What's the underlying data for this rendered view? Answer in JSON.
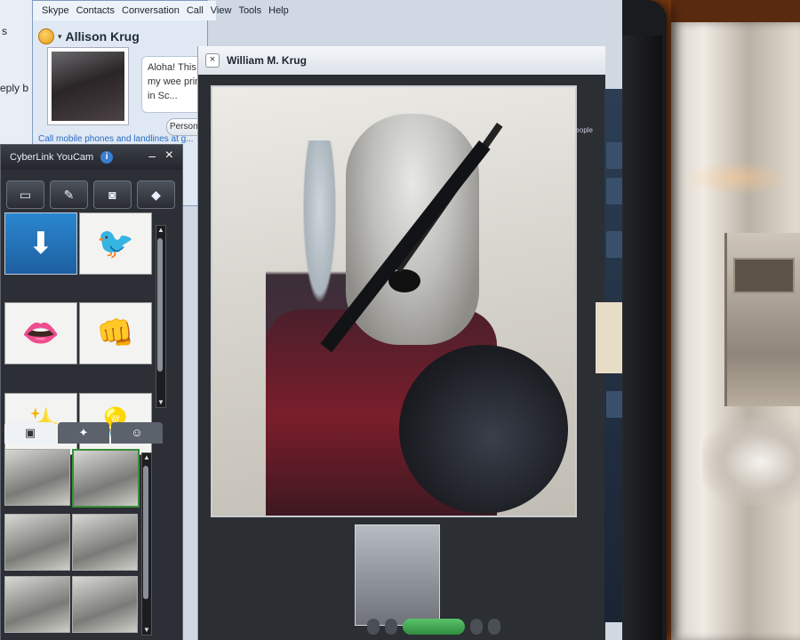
{
  "background_window": {
    "fragments": [
      "s",
      "eply b"
    ]
  },
  "skype": {
    "menu": [
      "Skype",
      "Contacts",
      "Conversation",
      "Call",
      "View",
      "Tools",
      "Help"
    ],
    "profile_name": "Allison Krug",
    "mood_message": "Aloha! This is my wee prince in Sc...",
    "personalize_label": "Personalize",
    "call_link": "Call mobile phones and landlines at g..."
  },
  "conversation": {
    "contact_name": "William M. Krug",
    "add_people": "Add people"
  },
  "youcam": {
    "title": "CyberLink YouCam",
    "info_icon": "info-icon",
    "minimize_label": "–",
    "close_label": "×",
    "toolbar_icons": [
      "folder-icon",
      "tools-icon",
      "camera-icon",
      "eraser-icon"
    ],
    "effects": [
      {
        "name": "download-effect",
        "glyph": "⬇"
      },
      {
        "name": "bird-effect",
        "glyph": "🐦"
      },
      {
        "name": "lips-effect",
        "glyph": "👄"
      },
      {
        "name": "punch-effect",
        "glyph": "👊"
      },
      {
        "name": "confetti-effect",
        "glyph": "✨"
      },
      {
        "name": "lightbulb-effect",
        "glyph": "💡"
      }
    ],
    "tabs": [
      {
        "name": "frame-tab",
        "glyph": "▣"
      },
      {
        "name": "magic-wand-tab",
        "glyph": "✦"
      },
      {
        "name": "emoticon-tab",
        "glyph": "☺"
      }
    ]
  },
  "colors": {
    "skype_accent": "#2a6cc4",
    "youcam_selected": "#1d5fa0",
    "call_green": "#2f8d3e"
  }
}
